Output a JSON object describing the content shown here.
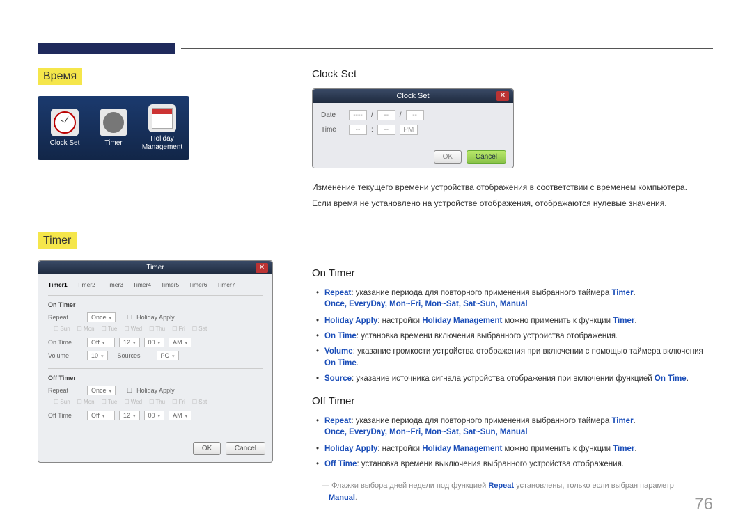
{
  "page_number": "76",
  "left": {
    "section_time": "Время",
    "section_timer": "Timer",
    "icons": {
      "clock_set": "Clock Set",
      "timer": "Timer",
      "holiday": "Holiday Management"
    },
    "timer_dialog": {
      "title": "Timer",
      "tabs": [
        "Timer1",
        "Timer2",
        "Timer3",
        "Timer4",
        "Timer5",
        "Timer6",
        "Timer7"
      ],
      "on_timer": "On Timer",
      "off_timer": "Off Timer",
      "repeat": "Repeat",
      "repeat_val": "Once",
      "holiday_apply": "Holiday Apply",
      "days": [
        "Sun",
        "Mon",
        "Tue",
        "Wed",
        "Thu",
        "Fri",
        "Sat"
      ],
      "on_time": "On Time",
      "on_time_val": "Off",
      "hh": "12",
      "mm": "00",
      "ampm": "AM",
      "volume": "Volume",
      "vol_val": "10",
      "sources": "Sources",
      "src_val": "PC",
      "off_time": "Off Time",
      "off_time_val": "Off",
      "ok": "OK",
      "cancel": "Cancel"
    }
  },
  "right": {
    "clock_set_head": "Clock Set",
    "clock_set_dialog": {
      "title": "Clock Set",
      "date": "Date",
      "time": "Time",
      "pm": "PM",
      "ok": "OK",
      "cancel": "Cancel",
      "dash": "----",
      "ddash": "--"
    },
    "clock_set_p1": "Изменение текущего времени устройства отображения в соответствии с временем компьютера.",
    "clock_set_p2": "Если время не установлено на устройстве отображения, отображаются нулевые значения.",
    "on_timer_head": "On Timer",
    "off_timer_head": "Off Timer",
    "kw": {
      "repeat": "Repeat",
      "timer": "Timer",
      "holiday_apply": "Holiday Apply",
      "holiday_mgmt": "Holiday Management",
      "on_time": "On Time",
      "off_time": "Off Time",
      "volume": "Volume",
      "source": "Source",
      "manual": "Manual"
    },
    "txt": {
      "repeat_desc": ": указание периода для повторного применения выбранного таймера ",
      "opts": "Once, EveryDay, Mon~Fri, Mon~Sat, Sat~Sun, Manual",
      "holiday_desc1": ": настройки ",
      "holiday_desc2": " можно применить к функции ",
      "on_time_desc": ": установка времени включения выбранного устройства отображения.",
      "volume_desc": ": указание громкости устройства отображения при включении с помощью таймера включения ",
      "source_desc": ": указание источника сигнала устройства отображения при включении функцией ",
      "off_time_desc": ": установка времени выключения выбранного устройства отображения.",
      "footnote_pre": "Флажки выбора дней недели под функцией ",
      "footnote_post": " установлены, только если выбран параметр "
    }
  }
}
